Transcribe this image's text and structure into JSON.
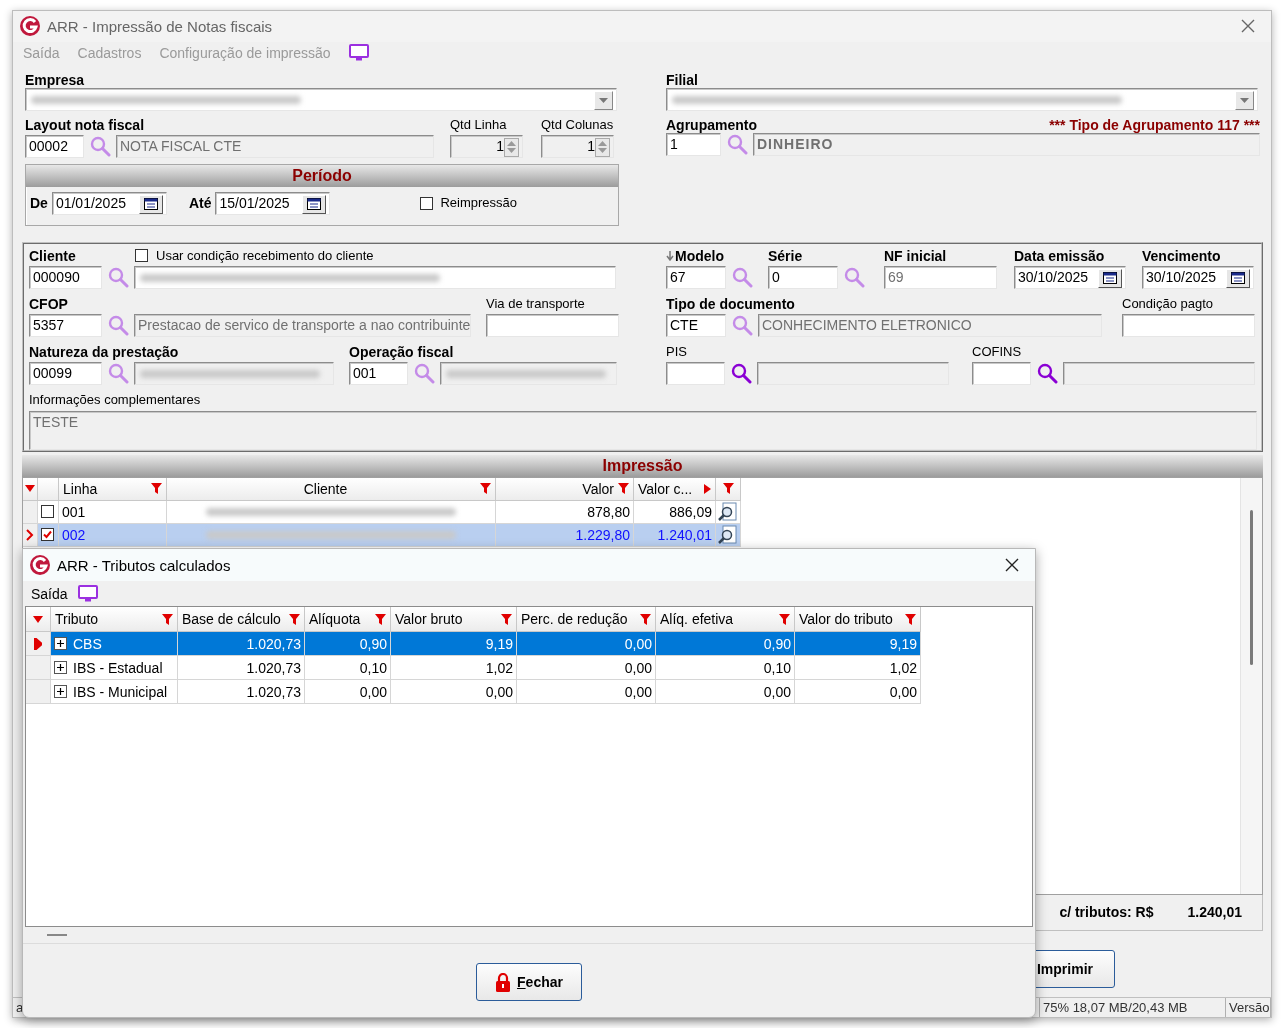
{
  "window": {
    "title": "ARR - Impressão de Notas fiscais"
  },
  "menu": [
    "Saída",
    "Cadastros",
    "Configuração de impressão"
  ],
  "empresa": {
    "label": "Empresa"
  },
  "filial": {
    "label": "Filial"
  },
  "layout": {
    "label": "Layout nota fiscal",
    "code": "00002",
    "description": "NOTA FISCAL CTE"
  },
  "qtd_linha": {
    "label": "Qtd Linha",
    "value": "1"
  },
  "qtd_colunas": {
    "label": "Qtd Colunas",
    "value": "1"
  },
  "agrupamento": {
    "label": "Agrupamento",
    "code": "1",
    "description": "DINHEIRO",
    "note": "*** Tipo de Agrupamento 117 ***"
  },
  "periodo": {
    "title": "Período",
    "from_label": "De",
    "from": "01/01/2025",
    "to_label": "Até",
    "to": "15/01/2025",
    "reprint": {
      "label": "Reimpressão",
      "checked": false
    }
  },
  "cliente": {
    "label": "Cliente",
    "code": "000090",
    "use_condition": {
      "label": "Usar condição recebimento do cliente",
      "checked": false
    }
  },
  "modelo": {
    "label": "Modelo",
    "code": "67"
  },
  "serie": {
    "label": "Série",
    "code": "0"
  },
  "nf_inicial": {
    "label": "NF inicial",
    "value": "69"
  },
  "data_emissao": {
    "label": "Data emissão",
    "value": "30/10/2025"
  },
  "vencimento": {
    "label": "Vencimento",
    "value": "30/10/2025"
  },
  "cfop": {
    "label": "CFOP",
    "code": "5357",
    "description": "Prestacao de servico de transporte a nao contribuinte"
  },
  "via_transporte": {
    "label": "Via de transporte"
  },
  "tipo_documento": {
    "label": "Tipo de documento",
    "code": "CTE",
    "description": "CONHECIMENTO ELETRONICO"
  },
  "condicao_pagto": {
    "label": "Condição pagto"
  },
  "natureza": {
    "label": "Natureza da prestação",
    "code": "00099"
  },
  "operacao": {
    "label": "Operação fiscal",
    "code": "001"
  },
  "pis": {
    "label": "PIS"
  },
  "cofins": {
    "label": "COFINS"
  },
  "info": {
    "label": "Informações complementares",
    "value": "TESTE"
  },
  "impressao": {
    "title": "Impressão",
    "columns": [
      "Linha",
      "Cliente",
      "Valor",
      "Valor c..."
    ],
    "rows": [
      {
        "linha": "001",
        "valor": "878,80",
        "valor_c": "886,09",
        "checked": false,
        "selected": false
      },
      {
        "linha": "002",
        "valor": "1.229,80",
        "valor_c": "1.240,01",
        "checked": true,
        "selected": true
      }
    ],
    "total_label": "c/ tributos: R$",
    "total": "1.240,01"
  },
  "print_button": "Imprimir",
  "status_bar": [
    "a",
    "75% 18,07 MB/20,43 MB",
    "Versão"
  ],
  "dialog": {
    "title": "ARR - Tributos calculados",
    "menu": [
      "Saída"
    ],
    "columns": [
      "Tributo",
      "Base de cálculo",
      "Alíquota",
      "Valor bruto",
      "Perc. de redução",
      "Alíq. efetiva",
      "Valor do tributo"
    ],
    "rows": [
      {
        "tributo": "CBS",
        "values": [
          "1.020,73",
          "0,90",
          "9,19",
          "0,00",
          "0,90",
          "9,19"
        ],
        "selected": true,
        "expanded": false
      },
      {
        "tributo": "IBS - Estadual",
        "values": [
          "1.020,73",
          "0,10",
          "1,02",
          "0,00",
          "0,10",
          "1,02"
        ],
        "selected": false,
        "expanded": false
      },
      {
        "tributo": "IBS - Municipal",
        "values": [
          "1.020,73",
          "0,00",
          "0,00",
          "0,00",
          "0,00",
          "0,00"
        ],
        "selected": false,
        "expanded": false
      }
    ],
    "close_button": "Fechar"
  }
}
